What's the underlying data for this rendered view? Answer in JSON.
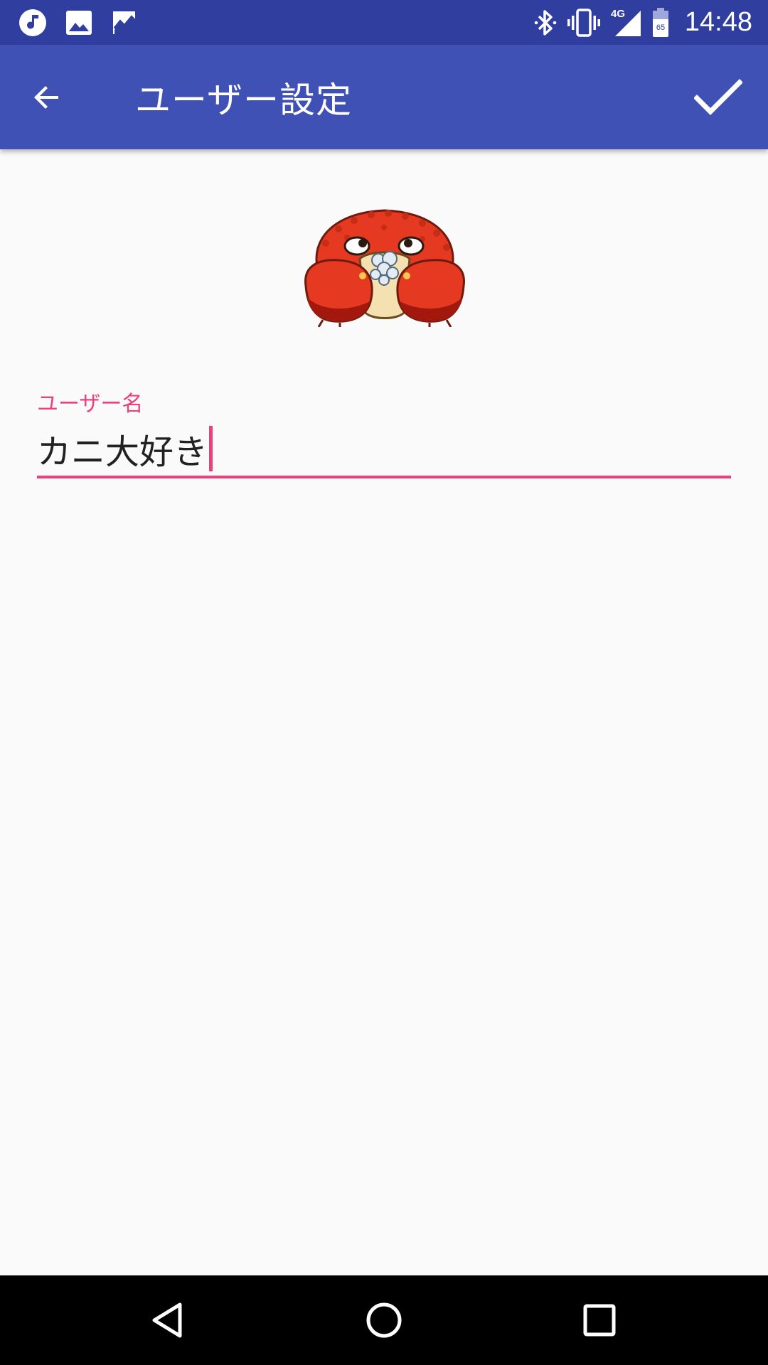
{
  "status_bar": {
    "time": "14:48",
    "network": "4G",
    "battery": "65",
    "left_icons": [
      "music-note-icon",
      "image-icon",
      "trending-icon"
    ],
    "right_icons": [
      "bluetooth-icon",
      "vibrate-icon",
      "signal-icon",
      "battery-icon"
    ]
  },
  "app_bar": {
    "title": "ユーザー設定",
    "back_icon": "arrow-back-icon",
    "action_icon": "check-icon"
  },
  "avatar": {
    "icon": "crab-avatar"
  },
  "username_field": {
    "label": "ユーザー名",
    "value": "カニ大好き"
  },
  "nav_bar": {
    "icons": [
      "back-triangle-icon",
      "home-circle-icon",
      "recents-square-icon"
    ]
  },
  "colors": {
    "status_bar": "#303f9f",
    "app_bar": "#3f51b5",
    "accent": "#ec407a",
    "background": "#fafafa"
  }
}
